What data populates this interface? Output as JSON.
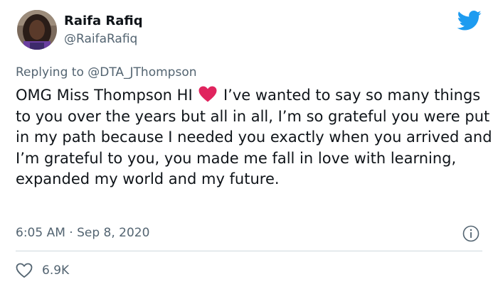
{
  "author": {
    "name": "Raifa Rafiq",
    "handle": "@RaifaRafiq",
    "avatar_icon": "profile-photo"
  },
  "reply": {
    "prefix": "Replying to ",
    "mention": "@DTA_JThompson"
  },
  "tweet": {
    "text_before_emoji": "OMG Miss Thompson HI ",
    "emoji": "red-heart",
    "text_after_emoji": " I’ve wanted to say so many things to you over the years but all in all, I’m so grateful you were put in my path because I needed you exactly when you arrived and I’m grateful to you, you made me fall in love with learning, expanded my world and my future."
  },
  "meta": {
    "time": "6:05 AM",
    "separator": " · ",
    "date": "Sep 8, 2020"
  },
  "actions": {
    "likes": "6.9K"
  },
  "colors": {
    "brand": "#1d9bf0",
    "heart": "#e0245e",
    "secondary_text": "#536471",
    "divider": "#cfd9de"
  },
  "icons": {
    "logo": "twitter-bird-icon",
    "info": "info-icon",
    "like": "heart-outline-icon"
  }
}
